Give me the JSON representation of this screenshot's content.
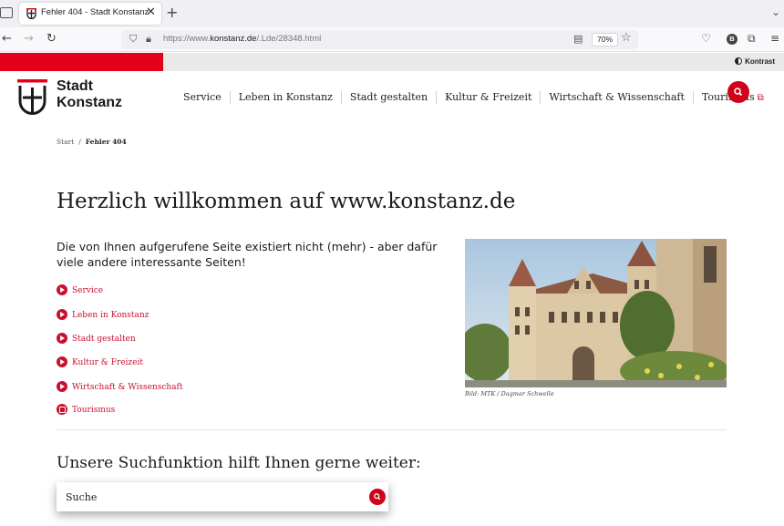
{
  "browser": {
    "tab_title": "Fehler 404 - Stadt Konstanz",
    "url_prefix": "https://www.",
    "url_domain": "konstanz.de",
    "url_path": "/.Lde/28348.html",
    "zoom": "70%",
    "profile_initial": "B"
  },
  "site": {
    "contrast_label": "Kontrast",
    "logo_line1": "Stadt",
    "logo_line2": "Konstanz",
    "nav": [
      "Service",
      "Leben in Konstanz",
      "Stadt gestalten",
      "Kultur & Freizeit",
      "Wirtschaft & Wissenschaft",
      "Tourismus"
    ],
    "colors": {
      "brand_red": "#e3001b",
      "link_red": "#c8102e"
    }
  },
  "breadcrumb": {
    "home": "Start",
    "separator": "/",
    "current": "Fehler 404"
  },
  "content": {
    "heading": "Herzlich willkommen auf www.konstanz.de",
    "intro": "Die von Ihnen aufgerufene Seite existiert nicht (mehr) - aber dafür viele andere interessante Seiten!",
    "links": [
      "Service",
      "Leben in Konstanz",
      "Stadt gestalten",
      "Kultur & Freizeit",
      "Wirtschaft & Wissenschaft",
      "Tourismus"
    ],
    "image_caption": "Bild: MTK / Dagmar Schwelle",
    "search_heading": "Unsere Suchfunktion hilft Ihnen gerne weiter:",
    "search_placeholder": "Suche"
  }
}
